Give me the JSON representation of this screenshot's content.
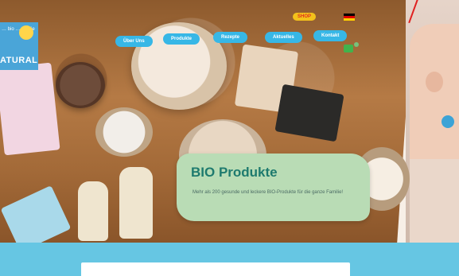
{
  "brand": {
    "logo_small": "… bio … für die",
    "logo_text": "ATURAL"
  },
  "nav": {
    "items": [
      "Über Uns",
      "Produkte",
      "Rezepte",
      "Aktuelles",
      "Kontakt"
    ],
    "shop_label": "SHOP"
  },
  "hero_card": {
    "title": "BIO Produkte",
    "text": "Mehr als 200 gesunde und leckere BIO-Produkte für die ganze Familie!"
  },
  "colors": {
    "nav": "#37b7e6",
    "card": "#b9dcb5",
    "title": "#1e7a6e",
    "band": "#66c6e3"
  },
  "icons": {
    "language": "german-flag-icon",
    "cart": "cart-icon"
  }
}
